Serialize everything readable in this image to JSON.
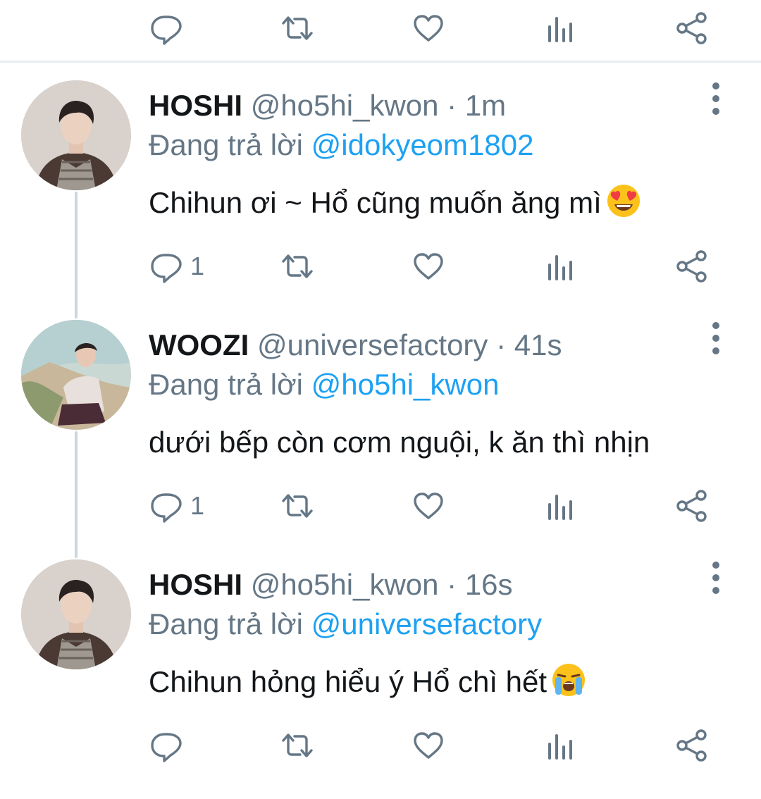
{
  "colors": {
    "icon": "#657786",
    "link": "#1da1f2",
    "divider": "#e6ecf0",
    "thread_line": "#ccd6dd"
  },
  "labels": {
    "replying_to": "Đang trả lời"
  },
  "icons": [
    "reply-icon",
    "retweet-icon",
    "like-icon",
    "analytics-icon",
    "share-icon",
    "more-icon"
  ],
  "tweets": [
    {
      "name": "HOSHI",
      "handle": "@ho5hi_kwon",
      "time": "· 1m",
      "reply_to": "@idokyeom1802",
      "text": "Chihun ơi ~ Hổ cũng muốn ăng mì",
      "emoji": "smiling-face-with-heart-eyes",
      "reply_count": "1"
    },
    {
      "name": "WOOZI",
      "handle": "@universefactory",
      "time": "· 41s",
      "reply_to": "@ho5hi_kwon",
      "text": "dưới bếp còn cơm nguội, k ăn thì nhịn",
      "emoji": "",
      "reply_count": "1"
    },
    {
      "name": "HOSHI",
      "handle": "@ho5hi_kwon",
      "time": "· 16s",
      "reply_to": "@universefactory",
      "text": "Chihun hỏng hiểu ý Hổ chì hết",
      "emoji": "loudly-crying-face",
      "reply_count": ""
    }
  ]
}
